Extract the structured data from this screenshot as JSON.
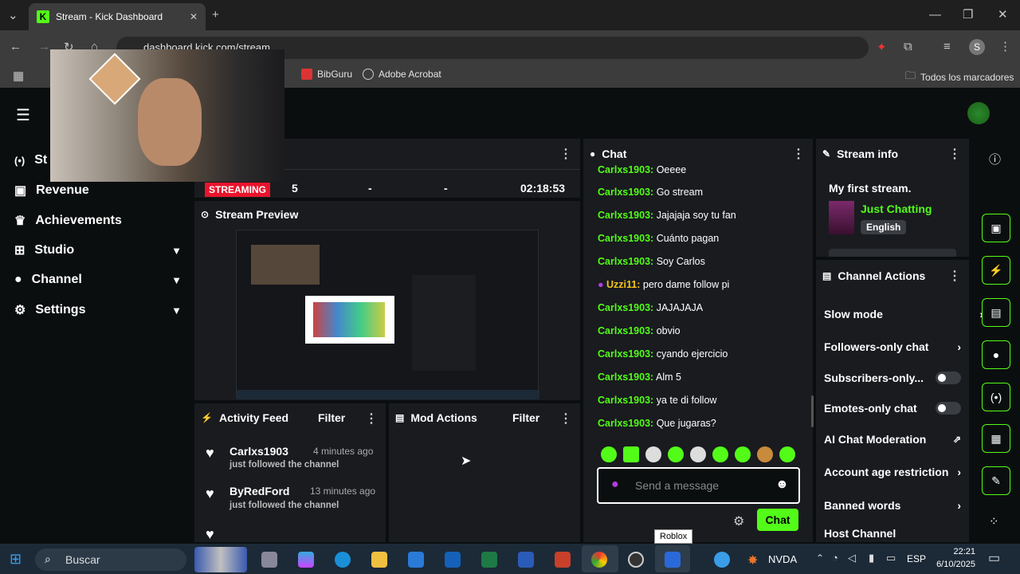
{
  "browser": {
    "tab_title": "Stream - Kick Dashboard",
    "url": "dashboard.kick.com/stream",
    "bookmarks": [
      "BibGuru",
      "Adobe Acrobat"
    ],
    "all_bookmarks": "Todos los marcadores",
    "profile_initial": "S"
  },
  "sidebar": {
    "items": [
      {
        "label": "St",
        "icon": "broadcast-icon"
      },
      {
        "label": "Revenue",
        "icon": "dollar-icon"
      },
      {
        "label": "Achievements",
        "icon": "trophy-icon"
      },
      {
        "label": "Studio",
        "icon": "mic-icon"
      },
      {
        "label": "Channel",
        "icon": "person-icon"
      },
      {
        "label": "Settings",
        "icon": "gear-icon"
      }
    ]
  },
  "stream_stats": {
    "status": "STREAMING",
    "viewers": "5",
    "stat2": "-",
    "stat3": "-",
    "uptime": "02:18:53"
  },
  "preview": {
    "title": "Stream Preview"
  },
  "activity": {
    "title": "Activity Feed",
    "filter": "Filter",
    "items": [
      {
        "user": "Carlxs1903",
        "time": "4 minutes ago",
        "text": "just followed the channel"
      },
      {
        "user": "ByRedFord",
        "time": "13 minutes ago",
        "text": "just followed the channel"
      }
    ]
  },
  "mod_actions": {
    "title": "Mod Actions",
    "filter": "Filter"
  },
  "chat": {
    "title": "Chat",
    "messages": [
      {
        "user": "Carlxs1903:",
        "text": "Oeeee"
      },
      {
        "user": "Carlxs1903:",
        "text": "Go stream"
      },
      {
        "user": "Carlxs1903:",
        "text": "Jajajaja soy tu fan"
      },
      {
        "user": "Carlxs1903:",
        "text": "Cuánto pagan"
      },
      {
        "user": "Carlxs1903:",
        "text": "Soy Carlos"
      },
      {
        "user": "Uzzi11:",
        "text": "pero dame follow pi"
      },
      {
        "user": "Carlxs1903:",
        "text": "JAJAJAJA"
      },
      {
        "user": "Carlxs1903:",
        "text": "obvio"
      },
      {
        "user": "Carlxs1903:",
        "text": "cyando ejercicio"
      },
      {
        "user": "Carlxs1903:",
        "text": "Alm 5"
      },
      {
        "user": "Carlxs1903:",
        "text": "ya te di follow"
      },
      {
        "user": "Carlxs1903:",
        "text": "Que jugaras?"
      }
    ],
    "placeholder": "Send a message",
    "send_label": "Chat",
    "tooltip": "Roblox",
    "accent": "#53fc18",
    "uzzi_color": "#f5c518"
  },
  "stream_info": {
    "title": "Stream info",
    "stream_title": "My first stream.",
    "category": "Just Chatting",
    "language": "English"
  },
  "channel_actions": {
    "title": "Channel Actions",
    "items": [
      {
        "label": "Slow mode",
        "control": "arrow"
      },
      {
        "label": "Followers-only chat",
        "control": "arrow"
      },
      {
        "label": "Subscribers-only...",
        "control": "toggle"
      },
      {
        "label": "Emotes-only chat",
        "control": "toggle"
      },
      {
        "label": "AI Chat Moderation",
        "control": "external"
      },
      {
        "label": "Account age restriction",
        "control": "arrow"
      },
      {
        "label": "Banned words",
        "control": "arrow"
      },
      {
        "label": "Host Channel",
        "control": "none"
      }
    ]
  },
  "taskbar": {
    "search": "Buscar",
    "nvda": "NVDA",
    "lang": "ESP",
    "time": "22:21",
    "date": "6/10/2025"
  }
}
